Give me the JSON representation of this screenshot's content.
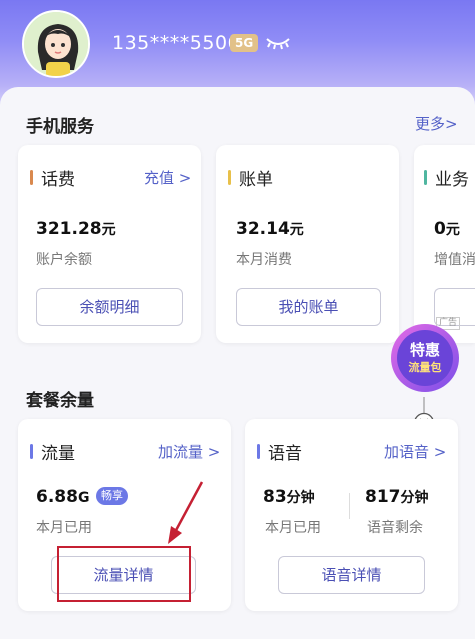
{
  "header": {
    "phone": "135****5506",
    "network_badge": "5G",
    "eye_icon": "eye-closed-icon",
    "avatar_icon": "cartoon-girl-avatar"
  },
  "mobile_service": {
    "title": "手机服务",
    "more_label": "更多>",
    "cards": [
      {
        "title": "话费",
        "link": "充值 >",
        "amount": "321.28",
        "unit": "元",
        "sub": "账户余额",
        "button": "余额明细",
        "accent": "#d9894e"
      },
      {
        "title": "账单",
        "amount": "32.14",
        "unit": "元",
        "sub": "本月消费",
        "button": "我的账单",
        "accent": "#e8c04a"
      },
      {
        "title": "业务",
        "amount": "0",
        "unit": "元",
        "sub": "增值消",
        "ad_tag": "广告",
        "accent": "#4fb6a0"
      }
    ]
  },
  "package": {
    "title": "套餐余量",
    "data_card": {
      "title": "流量",
      "link": "加流量 >",
      "amount": "6.88",
      "unit": "G",
      "badge": "畅享",
      "sub": "本月已用",
      "button": "流量详情",
      "accent": "#6c78e6"
    },
    "voice_card": {
      "title": "语音",
      "link": "加语音 >",
      "used_amount": "83",
      "used_unit": "分钟",
      "used_label": "本月已用",
      "remain_amount": "817",
      "remain_unit": "分钟",
      "remain_label": "语音剩余",
      "button": "语音详情",
      "accent": "#6c78e6"
    }
  },
  "promo": {
    "line1": "特惠",
    "line2": "流量包",
    "close_icon": "close-circle-icon"
  },
  "colors": {
    "link": "#5562c8",
    "highlight_box": "#c52033"
  }
}
